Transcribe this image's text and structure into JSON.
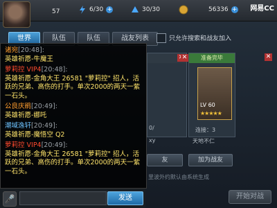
{
  "topbar": {
    "level": "57",
    "stamina": "6/30",
    "energy": "30/30",
    "gold": "56336",
    "logo": "网易CC"
  },
  "tabs": [
    {
      "label": "世界",
      "active": true
    },
    {
      "label": "队伍",
      "active": false
    },
    {
      "label": "队伍",
      "active": false
    },
    {
      "label": "战友列表",
      "active": false
    }
  ],
  "options": {
    "allow_search_label": "只允许搜索和战友加入"
  },
  "cards": [
    {
      "header": "",
      "lv": "",
      "text1": "0/",
      "text2": "",
      "btn": "友"
    },
    {
      "header": "准备完毕",
      "lv": "LV 60",
      "text1": "连接：3",
      "text2": "天地不仁",
      "btn": "加为战友"
    }
  ],
  "chat": {
    "messages": [
      {
        "name": "诸宛",
        "time": "[20:48]:",
        "body": "英雄祈愿-牛魔王",
        "style": "orange"
      },
      {
        "name": "萝莉控 VIP4",
        "time": "[20:48]:",
        "body": "英雄祈愿-金角大王 26581 \"萝莉控\" 招人，活跃的兄弟、高伤的打手。单次2000的两天一紫一石头。",
        "style": "vip"
      },
      {
        "name": "公良庆鹃",
        "time": "[20:49]:",
        "body": "英雄祈愿-娜吒",
        "style": "orange"
      },
      {
        "name": "潮域逸轩",
        "time": "[20:49]:",
        "body": "英雄祈愿-魔悟空 Q2",
        "style": "blue"
      },
      {
        "name": "萝莉控 VIP4",
        "time": "[20:49]:",
        "body": "英雄祈愿-金角大王 26581 \"萝莉控\" 招人，活跃的兄弟、高伤的打手。单次2000的两天一紫一石头。",
        "style": "vip"
      }
    ],
    "input_placeholder": "",
    "send_label": "发送"
  },
  "start_label": "开始对战",
  "hint": "里波外约默认由系统生成"
}
